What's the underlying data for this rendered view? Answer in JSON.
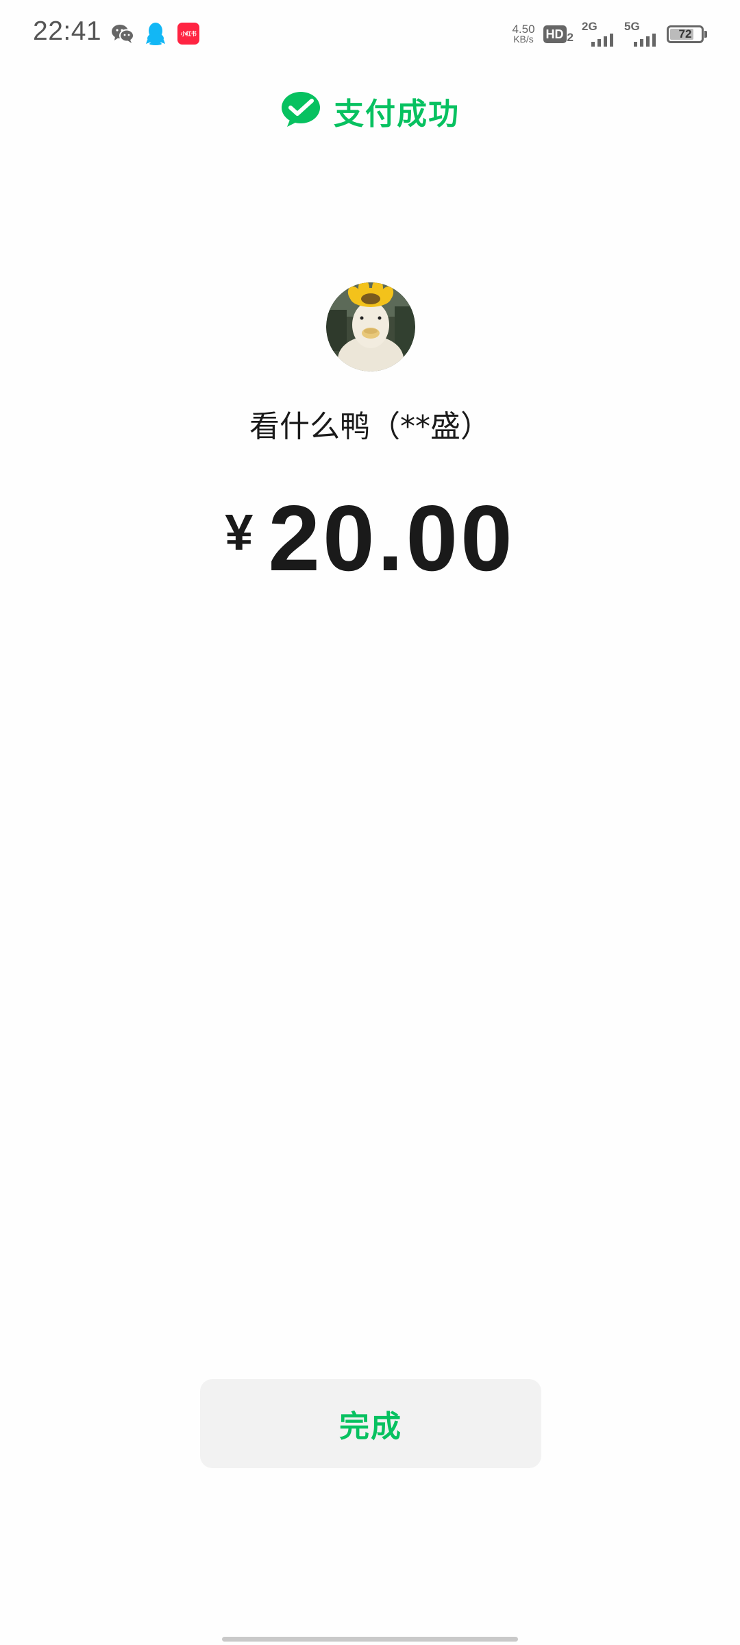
{
  "status_bar": {
    "time": "22:41",
    "app_icons": [
      "wechat-icon",
      "qq-icon",
      "xiaohongshu-icon"
    ],
    "xiaohongshu_label": "小红书",
    "net_speed_value": "4.50",
    "net_speed_unit": "KB/s",
    "hd_label": "HD",
    "hd_sub": "2",
    "signal_1_label": "2G",
    "signal_2_label": "5G",
    "battery_level": "72"
  },
  "header": {
    "icon": "wechat-pay-check-icon",
    "title": "支付成功",
    "accent_color": "#07c160"
  },
  "payment": {
    "avatar_icon": "duck-avatar",
    "payee": "看什么鸭（**盛）",
    "currency_symbol": "¥",
    "amount": "20.00"
  },
  "actions": {
    "done_label": "完成"
  }
}
